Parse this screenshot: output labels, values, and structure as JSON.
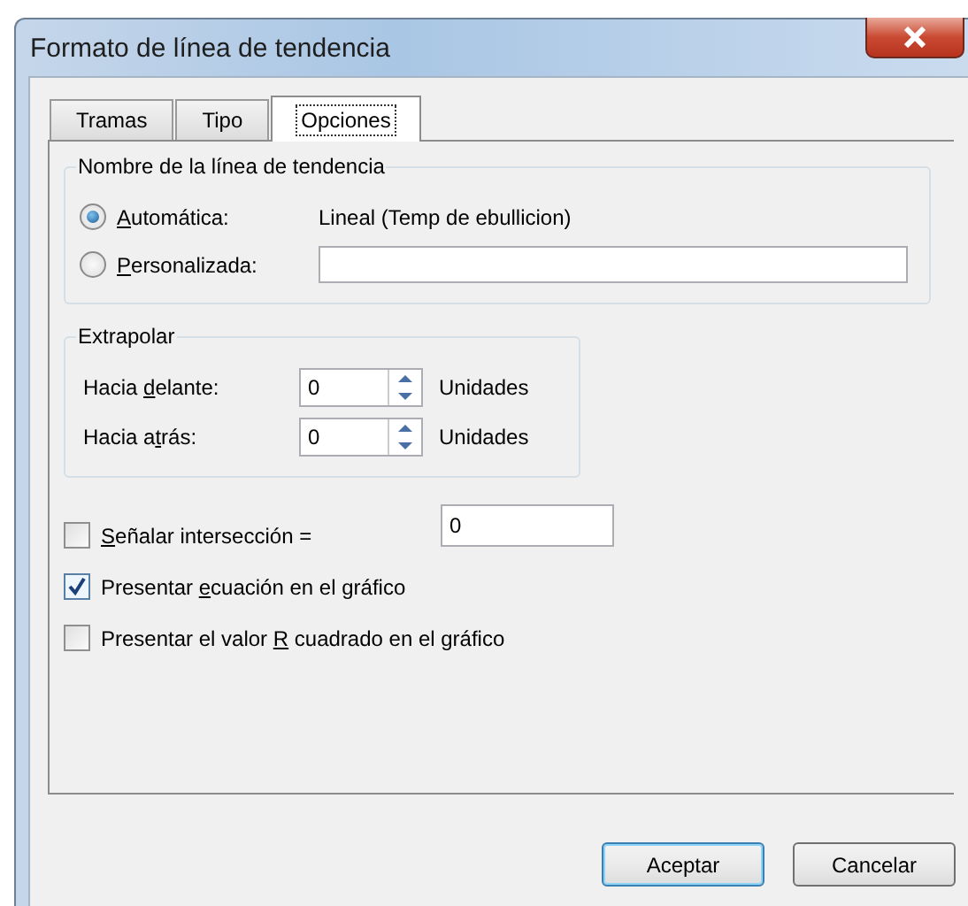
{
  "window": {
    "title": "Formato de línea de tendencia"
  },
  "tabs": [
    {
      "label": "Tramas",
      "selected": false
    },
    {
      "label": "Tipo",
      "selected": false
    },
    {
      "label": "Opciones",
      "selected": true
    }
  ],
  "name_group": {
    "title": "Nombre de la línea de tendencia",
    "options": [
      {
        "kind": "text",
        "access_key": "A",
        "label_after": "utomática:",
        "selected": true,
        "value": "Lineal (Temp de ebullicion)"
      },
      {
        "kind": "field",
        "access_key": "P",
        "label_after": "ersonalizada:",
        "selected": false
      }
    ]
  },
  "extrapolate": {
    "title": "Extrapolar",
    "rows": [
      {
        "label_before": "Hacia ",
        "access_key": "d",
        "label_after": "elante:",
        "value": "0",
        "unit": "Unidades"
      },
      {
        "label_before": "Hacia a",
        "access_key": "t",
        "label_after": "rás:",
        "value": "0",
        "unit": "Unidades"
      }
    ]
  },
  "checks": [
    {
      "kind": "field",
      "access_key": "S",
      "label_after": "eñalar intersección =",
      "checked": false,
      "value": "0"
    },
    {
      "kind": "plain",
      "label_before": "Presentar ",
      "access_key": "e",
      "label_after": "cuación en el gráfico",
      "checked": true
    },
    {
      "kind": "plain",
      "label_before": "Presentar el valor ",
      "access_key": "R",
      "label_after": " cuadrado en el gráfico",
      "checked": false
    }
  ],
  "buttons": [
    {
      "label": "Aceptar",
      "default": true
    },
    {
      "label": "Cancelar",
      "default": false
    }
  ]
}
